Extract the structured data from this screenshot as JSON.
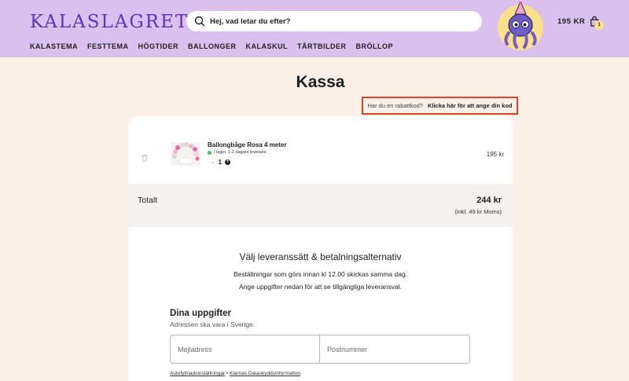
{
  "header": {
    "logo": "KALASLAGRET",
    "search_placeholder": "Hej, vad letar du efter?",
    "cart_total": "195 KR",
    "cart_count": "1",
    "nav": [
      "KALASTEMA",
      "FESTTEMA",
      "HÖGTIDER",
      "BALLONGER",
      "KALASKUL",
      "TÅRTBILDER",
      "BRÖLLOP"
    ]
  },
  "page": {
    "title": "Kassa",
    "discount_question": "Har du en rabattkod?",
    "discount_link": "Klicka här för att ange din kod"
  },
  "cart_item": {
    "name": "Ballongbåge Rosa 4 meter",
    "stock": "I lager, 1-2 dagars leverans",
    "quantity": "1",
    "minus": "-",
    "plus": "+",
    "price": "195 kr"
  },
  "totals": {
    "label": "Totalt",
    "value": "244 kr",
    "vat": "(inkl. 49 kr Moms)"
  },
  "delivery": {
    "title": "Välj leveranssätt & betalningsalternativ",
    "line1": "Beställningar som görs innan kl 12.00 skickas samma dag.",
    "line2": "Ange uppgifter nedan för att se tillgängliga leveransval."
  },
  "details": {
    "title": "Dina uppgifter",
    "subtitle": "Adressen ska vara i Sverige.",
    "email_placeholder": "Mejladress",
    "postal_placeholder": "Postnummer",
    "link_autofill": "Autofyllnadsinställningar",
    "separator": " • ",
    "link_privacy": "Klarnas Dataskyddsinformation"
  },
  "colors": {
    "header_bg": "#d9c0ef",
    "logo": "#5a35b8",
    "page_bg": "#fcefe6",
    "highlight": "#d9452b",
    "stock_dot": "#47b96b",
    "mascot_bg": "#fbe08a"
  },
  "icons": {
    "search": "search-icon",
    "cart": "shopping-bag-icon",
    "trash": "trash-icon",
    "mascot": "octopus-mascot"
  }
}
